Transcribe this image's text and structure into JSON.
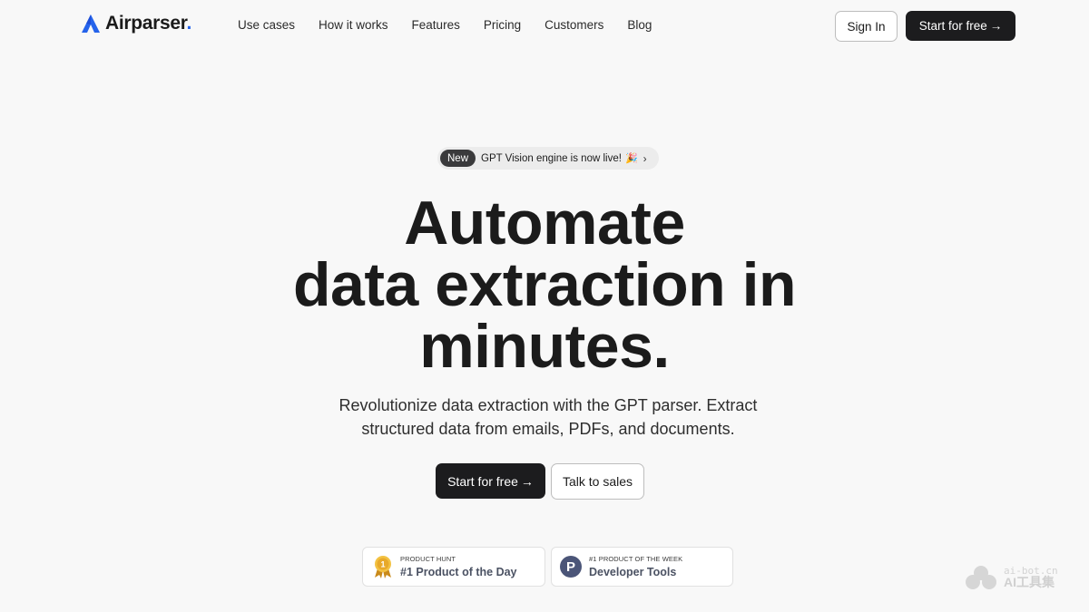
{
  "nav": {
    "logo_text": "Airparser",
    "logo_dot": ".",
    "links": [
      "Use cases",
      "How it works",
      "Features",
      "Pricing",
      "Customers",
      "Blog"
    ],
    "sign_in": "Sign In",
    "start": "Start for free",
    "arrow": "→"
  },
  "badge": {
    "tag": "New",
    "text": "GPT Vision engine is now live!",
    "emoji": "🎉",
    "chevron": "›"
  },
  "hero": {
    "title_lines": [
      "Automate",
      "data extraction in",
      "minutes."
    ],
    "subtitle_lines": [
      "Revolutionize data extraction with the GPT parser. Extract",
      "structured data from emails, PDFs, and documents."
    ],
    "cta_primary": "Start for free",
    "cta_arrow": "→",
    "cta_secondary": "Talk to sales"
  },
  "awards": [
    {
      "small": "PRODUCT HUNT",
      "big": "#1 Product of the Day",
      "icon": "medal-icon"
    },
    {
      "small": "#1 PRODUCT OF THE WEEK",
      "big": "Developer Tools",
      "icon": "producthunt-p-icon",
      "letter": "P"
    }
  ],
  "watermark": {
    "top": "ai-bot.cn",
    "bottom": "AI工具集"
  },
  "colors": {
    "accent": "#2563eb",
    "dark_button": "#1c1c1e",
    "background": "#f8f8f8"
  }
}
